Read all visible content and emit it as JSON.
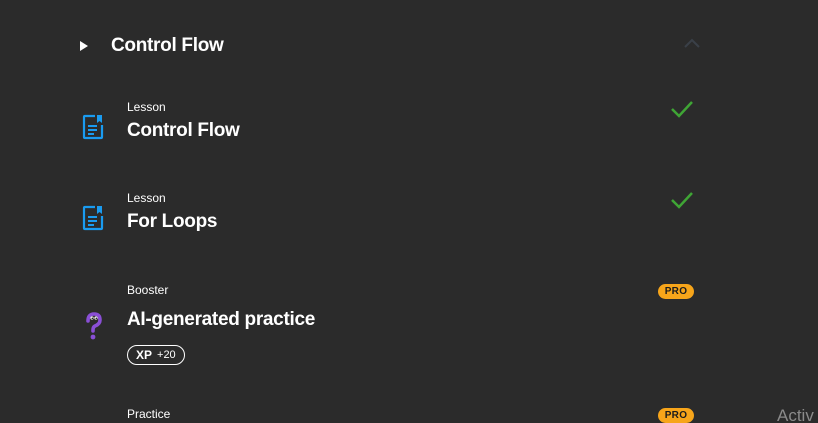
{
  "section": {
    "title": "Control Flow"
  },
  "items": [
    {
      "kind": "Lesson",
      "title": "Control Flow",
      "completed": true,
      "icon": "lesson-doc-icon"
    },
    {
      "kind": "Lesson",
      "title": "For Loops",
      "completed": true,
      "icon": "lesson-doc-icon"
    },
    {
      "kind": "Booster",
      "title": "AI-generated practice",
      "badge": "PRO",
      "xp_label": "XP",
      "xp_value": "+20",
      "icon": "question-mascot-icon"
    },
    {
      "kind": "Practice",
      "badge": "PRO"
    }
  ],
  "watermark": "Activ",
  "colors": {
    "background": "#2b2b2b",
    "accent_blue": "#1a9bf0",
    "check_green": "#3fa535",
    "pro_badge": "#f7a51a",
    "booster_purple": "#8a4fd6"
  }
}
